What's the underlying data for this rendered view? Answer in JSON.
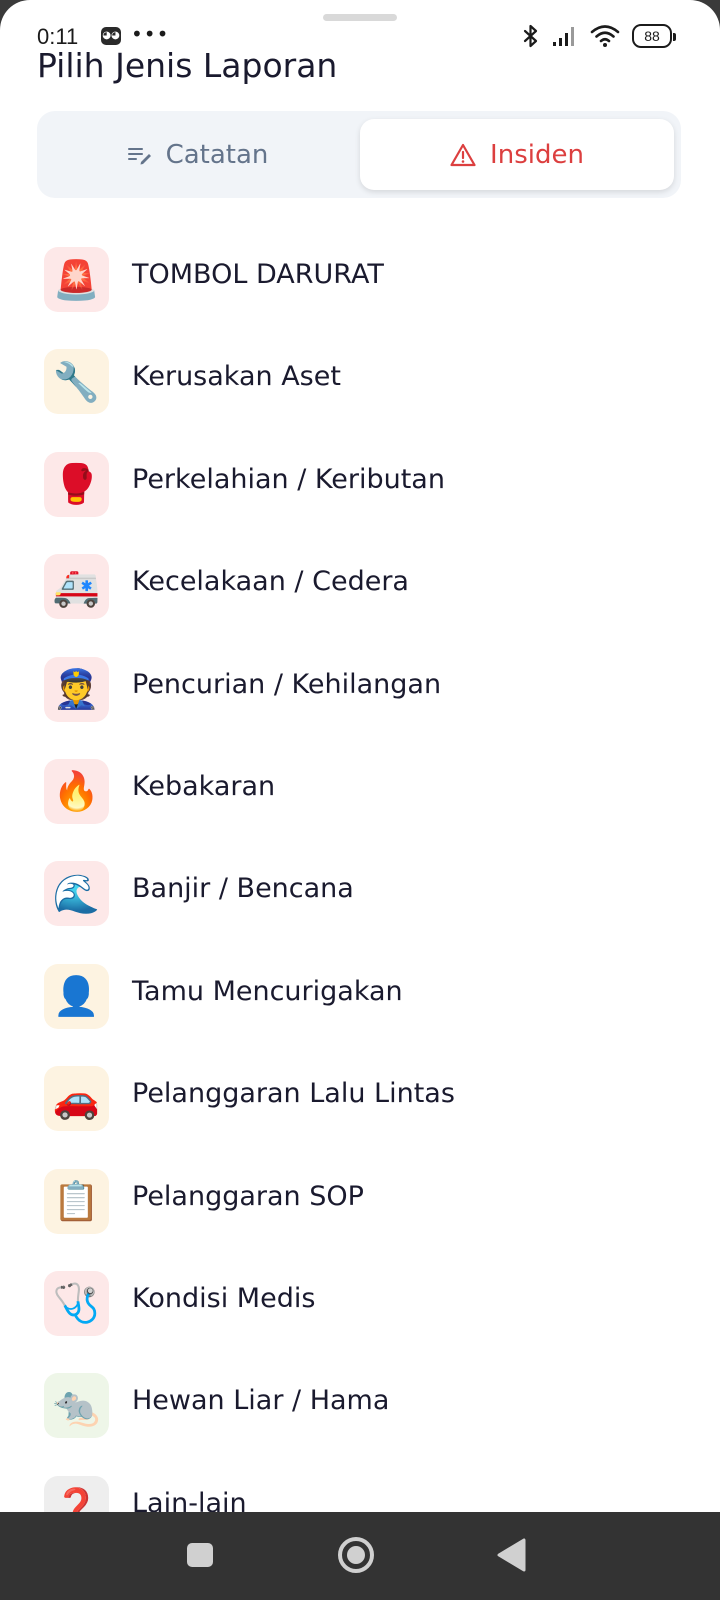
{
  "status_bar": {
    "time": "0:11",
    "dots": "•••",
    "battery": "88"
  },
  "header": {
    "title": "Pilih Jenis Laporan"
  },
  "tabs": [
    {
      "label": "Catatan",
      "icon": "notes-edit-icon",
      "selected": false,
      "color": "#64748b"
    },
    {
      "label": "Insiden",
      "icon": "warning-triangle-icon",
      "selected": true,
      "color": "#dc3f3f"
    }
  ],
  "incident_types": [
    {
      "label": "TOMBOL DARURAT",
      "emoji": "🚨",
      "icon": "siren-icon",
      "bg": "#fde8e8"
    },
    {
      "label": "Kerusakan Aset",
      "emoji": "🔧",
      "icon": "wrench-icon",
      "bg": "#fdf3e1"
    },
    {
      "label": "Perkelahian / Keributan",
      "emoji": "🥊",
      "icon": "boxing-glove-icon",
      "bg": "#fde8e8"
    },
    {
      "label": "Kecelakaan / Cedera",
      "emoji": "🚑",
      "icon": "ambulance-icon",
      "bg": "#fde8e8"
    },
    {
      "label": "Pencurian / Kehilangan",
      "emoji": "👮",
      "icon": "police-officer-icon",
      "bg": "#fde8e8"
    },
    {
      "label": "Kebakaran",
      "emoji": "🔥",
      "icon": "fire-icon",
      "bg": "#fde8e8"
    },
    {
      "label": "Banjir / Bencana",
      "emoji": "🌊",
      "icon": "water-wave-icon",
      "bg": "#fde8e8"
    },
    {
      "label": "Tamu Mencurigakan",
      "emoji": "👤",
      "icon": "person-silhouette-icon",
      "bg": "#fdf3e1"
    },
    {
      "label": "Pelanggaran Lalu Lintas",
      "emoji": "🚗",
      "icon": "car-icon",
      "bg": "#fdf3e1"
    },
    {
      "label": "Pelanggaran SOP",
      "emoji": "📋",
      "icon": "clipboard-icon",
      "bg": "#fdf3e1"
    },
    {
      "label": "Kondisi Medis",
      "emoji": "🩺",
      "icon": "stethoscope-icon",
      "bg": "#fde8e8"
    },
    {
      "label": "Hewan Liar / Hama",
      "emoji": "🐀",
      "icon": "rat-icon",
      "bg": "#eef6e8"
    },
    {
      "label": "Lain-lain",
      "emoji": "❓",
      "icon": "question-mark-icon",
      "bg": "#eeeeee"
    }
  ]
}
